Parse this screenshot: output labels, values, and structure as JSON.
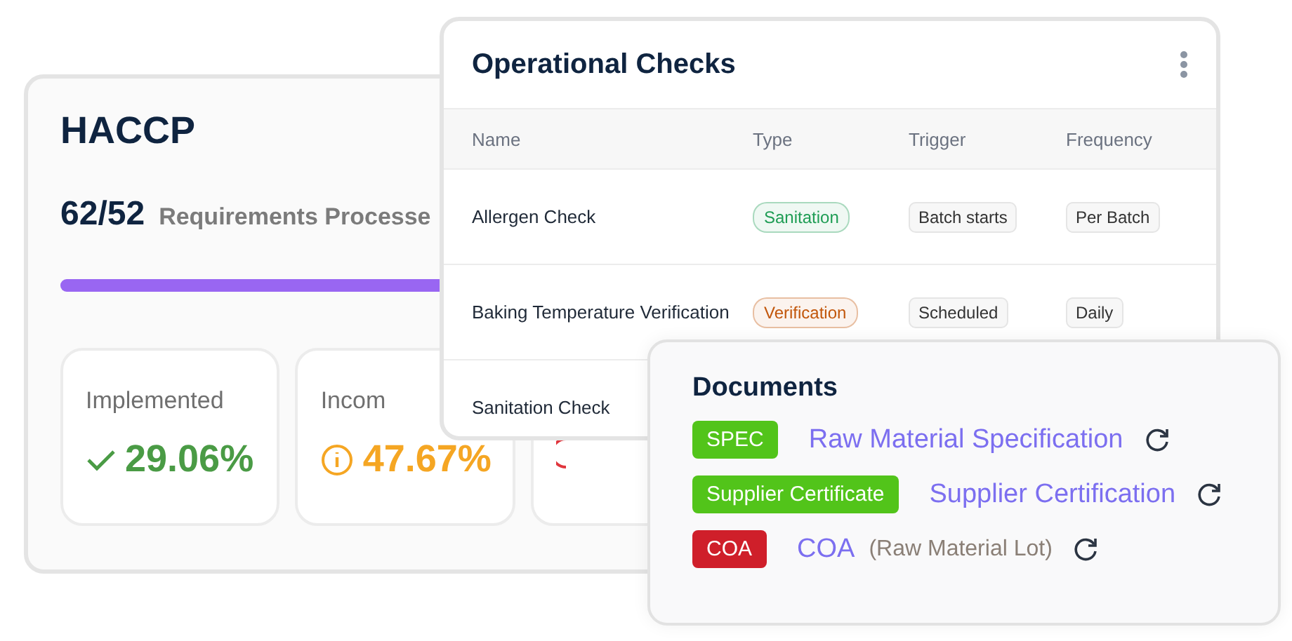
{
  "haccp": {
    "title": "HACCP",
    "count": "62/52",
    "count_label": "Requirements Processe",
    "progress": {
      "level": 1
    },
    "stats": [
      {
        "label": "Implemented",
        "value": "29.06%",
        "kind": "ok"
      },
      {
        "label": "Incom",
        "value": "47.67%",
        "kind": "warning"
      },
      {
        "kind": "error"
      }
    ]
  },
  "checks": {
    "title": "Operational Checks",
    "columns": [
      "Name",
      "Type",
      "Trigger",
      "Frequency"
    ],
    "rows": [
      {
        "name": "Allergen Check",
        "type": "Sanitation",
        "color": "#1f9d55",
        "trigger": "Batch starts",
        "frequency": "Per Batch"
      },
      {
        "name": "Baking Temperature Verification",
        "type": "Verification",
        "color": "#c2570c",
        "trigger": "Scheduled",
        "frequency": "Daily"
      },
      {
        "name": "Sanitation Check"
      }
    ]
  },
  "documents": {
    "title": "Documents",
    "items": [
      {
        "tag": "SPEC",
        "color": "#52c41a",
        "name": "Raw Material Specification"
      },
      {
        "tag": "Supplier Certificate",
        "color": "#52c41a",
        "name": "Supplier Certification"
      },
      {
        "tag": "COA",
        "color": "#cf1f2a",
        "name": "COA",
        "note": "(Raw Material Lot)"
      }
    ]
  }
}
